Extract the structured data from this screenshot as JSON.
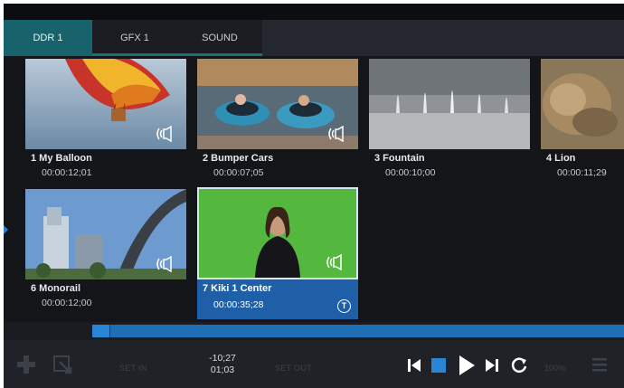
{
  "tabs": [
    {
      "label": "DDR 1",
      "active": true
    },
    {
      "label": "GFX 1",
      "active": false
    },
    {
      "label": "SOUND",
      "active": false
    }
  ],
  "clips": [
    {
      "title": "1 My Balloon",
      "time": "00:00:12;01",
      "audio": true,
      "selected": false
    },
    {
      "title": "2 Bumper Cars",
      "time": "00:00:07;05",
      "audio": true,
      "selected": false
    },
    {
      "title": "3 Fountain",
      "time": "00:00:10;00",
      "audio": false,
      "selected": false
    },
    {
      "title": "4 Lion",
      "time": "00:00:11;29",
      "audio": false,
      "selected": false
    },
    {
      "title": "6 Monorail",
      "time": "00:00:12;00",
      "audio": true,
      "selected": false
    },
    {
      "title": "7 Kiki 1 Center",
      "time": "00:00:35;28",
      "audio": true,
      "selected": true,
      "badge": "T"
    }
  ],
  "transport": {
    "set_in_label": "SET IN",
    "set_out_label": "SET OUT",
    "timecode_remaining": "-10;27",
    "timecode_duration": "01;03",
    "zoom_label": "100%"
  },
  "icons": {
    "add": "plus-icon",
    "import": "import-icon",
    "prev": "skip-previous-icon",
    "stop": "stop-icon",
    "play": "play-icon",
    "next": "skip-next-icon",
    "loop": "loop-icon",
    "list": "list-icon"
  },
  "colors": {
    "active_tab": "#17626b",
    "selected_clip": "#1f5fa8",
    "accent_blue": "#2a86d4",
    "background": "#131519"
  }
}
